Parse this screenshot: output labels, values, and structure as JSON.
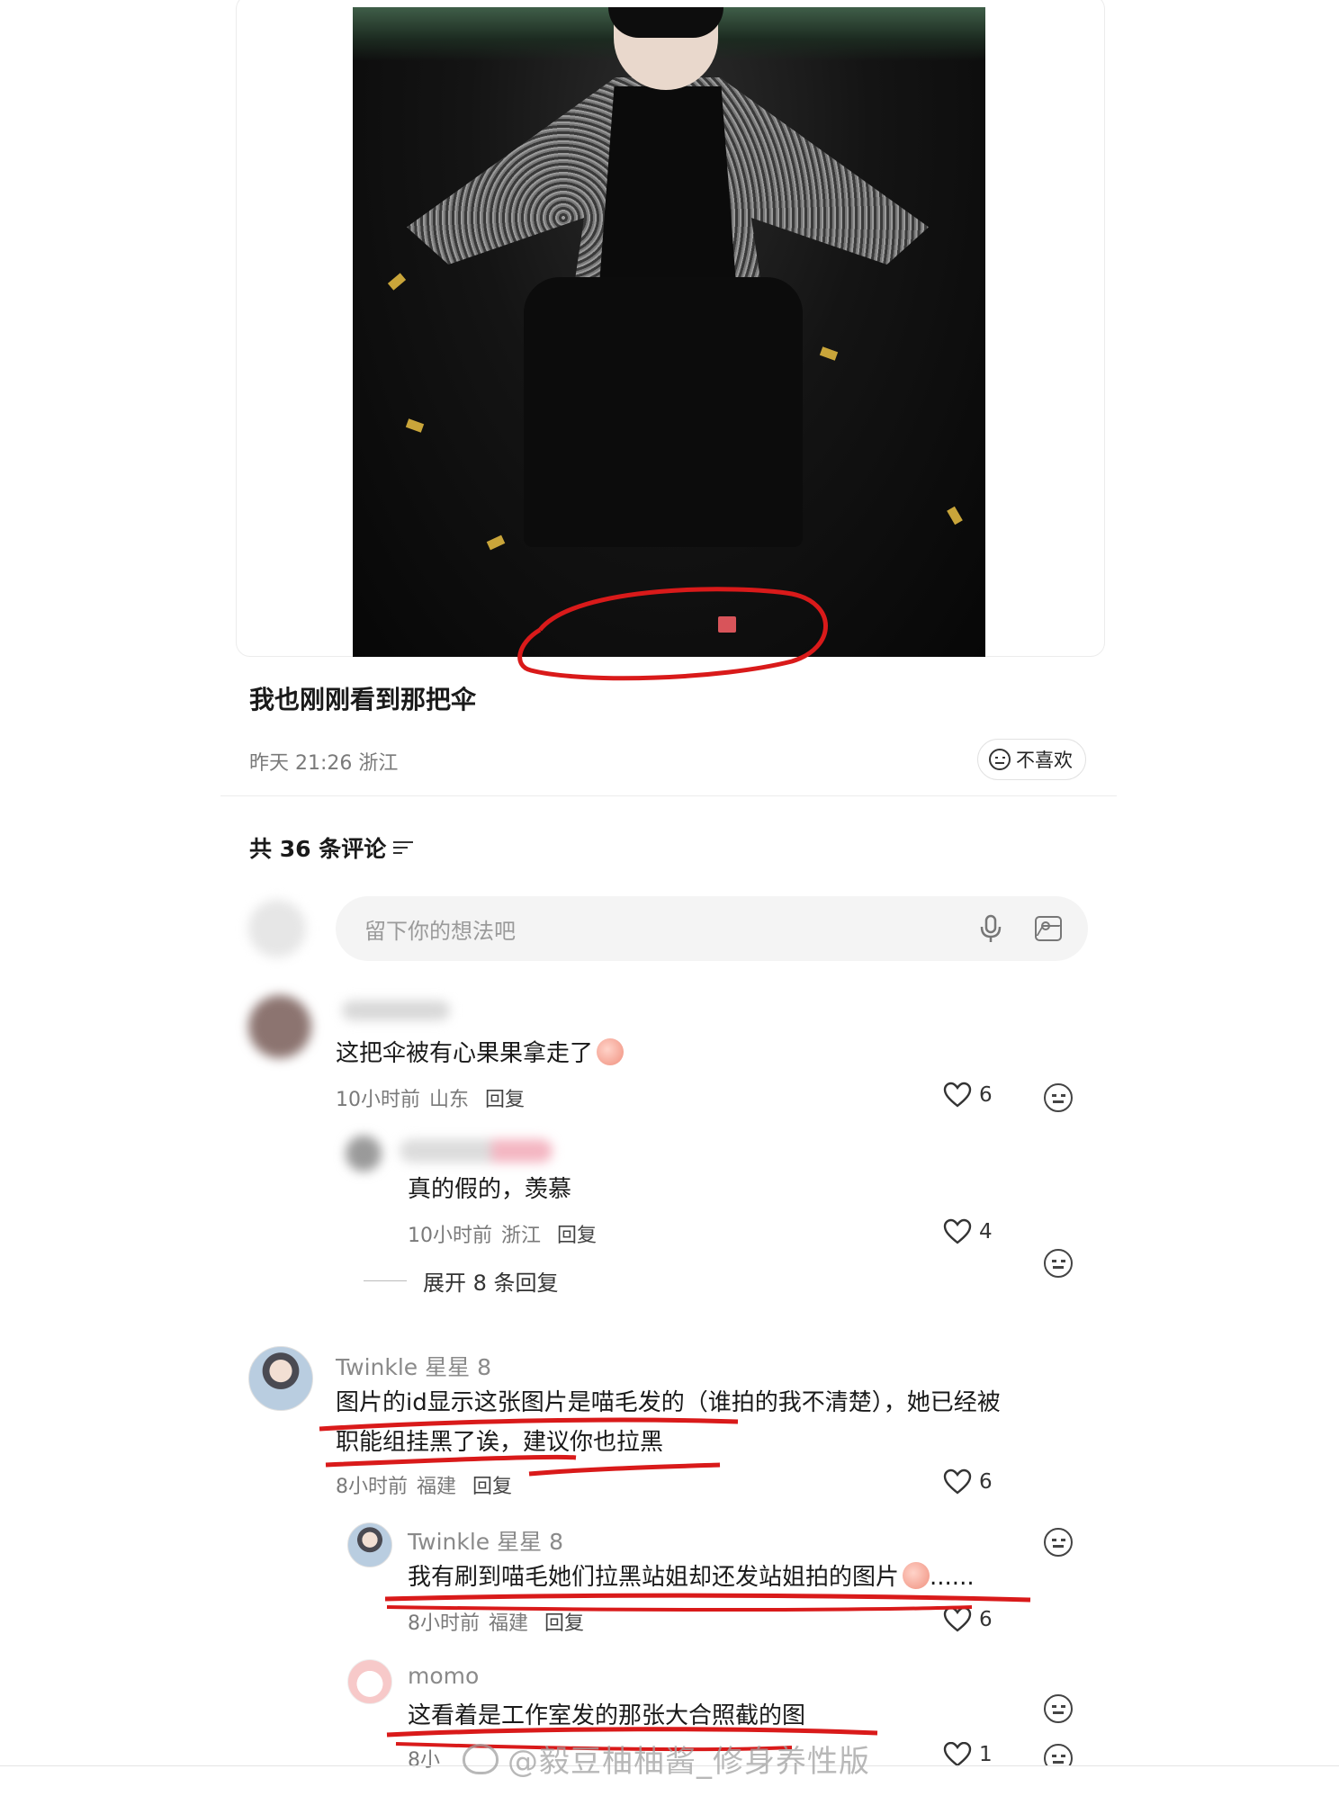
{
  "post": {
    "caption": "我也刚刚看到那把伞",
    "time": "昨天 21:26",
    "location": "浙江",
    "dislike_label": "不喜欢"
  },
  "comments_header": {
    "label": "共 36 条评论"
  },
  "input": {
    "placeholder": "留下你的想法吧"
  },
  "comments": [
    {
      "name": "",
      "text": "这把伞被有心果果拿走了",
      "time": "10小时前",
      "location": "山东",
      "reply": "回复",
      "likes": "6",
      "replies": [
        {
          "name": "",
          "text": "真的假的，羡慕",
          "time": "10小时前",
          "location": "浙江",
          "reply": "回复",
          "likes": "4"
        }
      ],
      "expand_label": "展开 8 条回复"
    },
    {
      "name": "Twinkle 星星 8",
      "text_line1": "图片的id显示这张图片是喵毛发的（谁拍的我不清楚），她已经被",
      "text_line2": "职能组挂黑了诶，建议你也拉黑",
      "time": "8小时前",
      "location": "福建",
      "reply": "回复",
      "likes": "6",
      "replies": [
        {
          "name": "Twinkle 星星 8",
          "text": "我有刷到喵毛她们拉黑站姐却还发站姐拍的图片",
          "text_suffix": "......",
          "time": "8小时前",
          "location": "福建",
          "reply": "回复",
          "likes": "6"
        },
        {
          "name": "momo",
          "text": "这看着是工作室发的那张大合照截的图",
          "time": "8小",
          "likes": "1"
        }
      ]
    }
  ],
  "watermark": "@毅豆柚柚酱_修身养性版",
  "colors": {
    "annotation_red": "#d91a1a",
    "muted_text": "#7a7a7a"
  }
}
